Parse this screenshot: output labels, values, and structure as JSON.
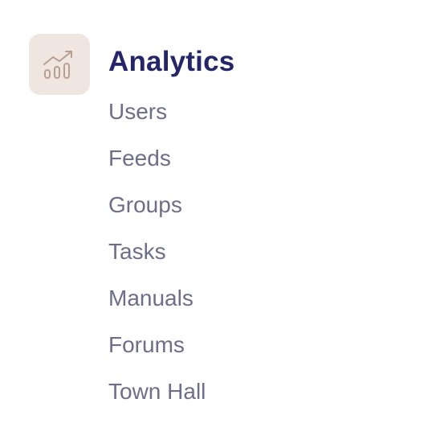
{
  "colors": {
    "heading": "#25266a",
    "item": "#6c6e8a",
    "icon_tile_bg": "#efe6e1",
    "icon_stroke": "#b89e8e"
  },
  "section": {
    "icon": "chart-trending-up-icon",
    "title": "Analytics",
    "items": [
      {
        "label": "Users"
      },
      {
        "label": "Feeds"
      },
      {
        "label": "Groups"
      },
      {
        "label": "Tasks"
      },
      {
        "label": "Manuals"
      },
      {
        "label": "Forums"
      },
      {
        "label": "Town Hall"
      }
    ]
  }
}
